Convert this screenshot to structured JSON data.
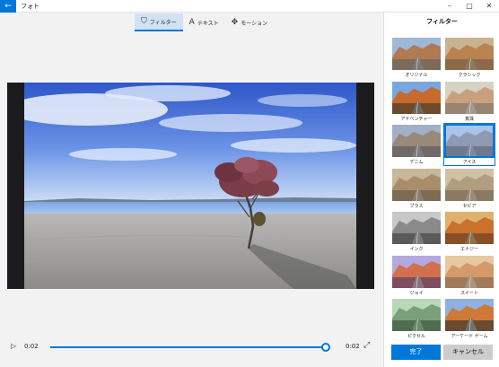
{
  "window": {
    "back_icon": "back-arrow-icon",
    "title": "フォト",
    "controls": [
      "minimize-icon",
      "maximize-icon",
      "close-icon"
    ]
  },
  "toolbar": {
    "tabs": [
      {
        "label": "フィルター",
        "icon": "filter-icon",
        "active": true
      },
      {
        "label": "テキスト",
        "icon": "text-icon",
        "active": false
      },
      {
        "label": "モーション",
        "icon": "motion-icon",
        "active": false
      }
    ]
  },
  "player": {
    "current_time": "0:02",
    "total_time": "0:02",
    "progress": 1.0
  },
  "panel": {
    "title": "フィルター",
    "filters": [
      {
        "label": "オリジナル",
        "style": "normal"
      },
      {
        "label": "クラシック",
        "style": "warm"
      },
      {
        "label": "アドベンチャー",
        "style": "vivid"
      },
      {
        "label": "真珠",
        "style": "pearl"
      },
      {
        "label": "デニム",
        "style": "denim"
      },
      {
        "label": "アイス",
        "style": "ice",
        "selected": true
      },
      {
        "label": "ブラス",
        "style": "brass"
      },
      {
        "label": "セピア",
        "style": "sepia"
      },
      {
        "label": "インク",
        "style": "ink"
      },
      {
        "label": "エナジー",
        "style": "energy"
      },
      {
        "label": "ジョイ",
        "style": "joy"
      },
      {
        "label": "スイート",
        "style": "sweet"
      },
      {
        "label": "ピクセル",
        "style": "pixel"
      },
      {
        "label": "アーケード ゲーム",
        "style": "arcade"
      }
    ],
    "done_label": "完了",
    "cancel_label": "キャンセル"
  },
  "colors": {
    "accent": "#0078d7"
  }
}
